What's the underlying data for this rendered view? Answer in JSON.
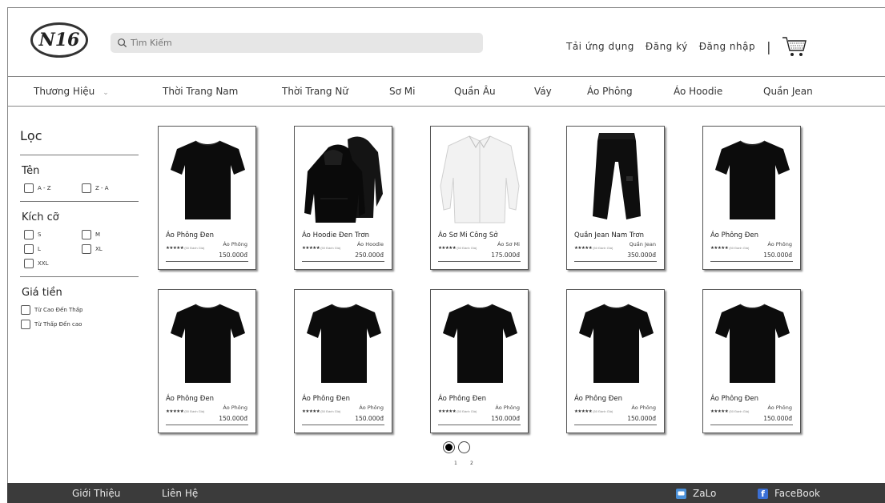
{
  "header": {
    "logo_text": "N16",
    "search_placeholder": "Tìm Kiếm",
    "links": [
      "Tải ứng dụng",
      "Đăng ký",
      "Đăng nhập"
    ],
    "separator": "|"
  },
  "nav": {
    "items": [
      "Thương Hiệu",
      "Thời Trang Nam",
      "Thời Trang Nữ",
      "Sơ Mi",
      "Quần Âu",
      "Váy",
      "Áo Phông",
      "Áo Hoodie",
      "Quần Jean"
    ]
  },
  "filter": {
    "title": "Lọc",
    "groups": [
      {
        "title": "Tên",
        "options": [
          "A - Z",
          "Z - A"
        ]
      },
      {
        "title": "Kích cỡ",
        "options": [
          "S",
          "M",
          "L",
          "XL",
          "XXL"
        ]
      },
      {
        "title": "Giá tiền",
        "options": [
          "Từ Cao Đến Thấp",
          "Từ Thấp Đến cao"
        ]
      }
    ]
  },
  "products": [
    {
      "name": "Áo Phông Đen",
      "category": "Áo Phông",
      "price": "150.000đ",
      "stars": "★★★★★",
      "reviews": "(50 Đánh Giá)",
      "image": "tshirt-icon"
    },
    {
      "name": "Áo Hoodie Đen Trơn",
      "category": "Áo Hoodie",
      "price": "250.000đ",
      "stars": "★★★★★",
      "reviews": "(50 Đánh Giá)",
      "image": "hoodie-icon"
    },
    {
      "name": "Áo Sơ Mi Công Sở",
      "category": "Áo Sơ Mi",
      "price": "175.000đ",
      "stars": "★★★★★",
      "reviews": "(50 Đánh Giá)",
      "image": "shirt-icon"
    },
    {
      "name": "Quần Jean Nam Trơn",
      "category": "Quần Jean",
      "price": "350.000đ",
      "stars": "★★★★★",
      "reviews": "(50 Đánh Giá)",
      "image": "pants-icon"
    },
    {
      "name": "Áo Phông Đen",
      "category": "Áo Phông",
      "price": "150.000đ",
      "stars": "★★★★★",
      "reviews": "(50 Đánh Giá)",
      "image": "tshirt-icon"
    },
    {
      "name": "Áo Phông Đen",
      "category": "Áo Phông",
      "price": "150.000đ",
      "stars": "★★★★★",
      "reviews": "(50 Đánh Giá)",
      "image": "tshirt-icon"
    },
    {
      "name": "Áo Phông Đen",
      "category": "Áo Phông",
      "price": "150.000đ",
      "stars": "★★★★★",
      "reviews": "(50 Đánh Giá)",
      "image": "tshirt-icon"
    },
    {
      "name": "Áo Phông Đen",
      "category": "Áo Phông",
      "price": "150.000đ",
      "stars": "★★★★★",
      "reviews": "(50 Đánh Giá)",
      "image": "tshirt-icon"
    },
    {
      "name": "Áo Phông Đen",
      "category": "Áo Phông",
      "price": "150.000đ",
      "stars": "★★★★★",
      "reviews": "(50 Đánh Giá)",
      "image": "tshirt-icon"
    },
    {
      "name": "Áo Phông Đen",
      "category": "Áo Phông",
      "price": "150.000đ",
      "stars": "★★★★★",
      "reviews": "(50 Đánh Giá)",
      "image": "tshirt-icon"
    }
  ],
  "pagination": {
    "pages": [
      "1",
      "2"
    ],
    "current": "1"
  },
  "footer": {
    "left": [
      "Giới Thiệu",
      "Liên Hệ"
    ],
    "right": [
      {
        "label": "ZaLo",
        "icon": "zalo-icon",
        "color": "#4a90d9"
      },
      {
        "label": "FaceBook",
        "icon": "facebook-icon",
        "color": "#3b6fd4"
      }
    ]
  },
  "colors": {
    "footer_bg": "#3b3b3b",
    "search_bg": "#e6e6e6"
  }
}
